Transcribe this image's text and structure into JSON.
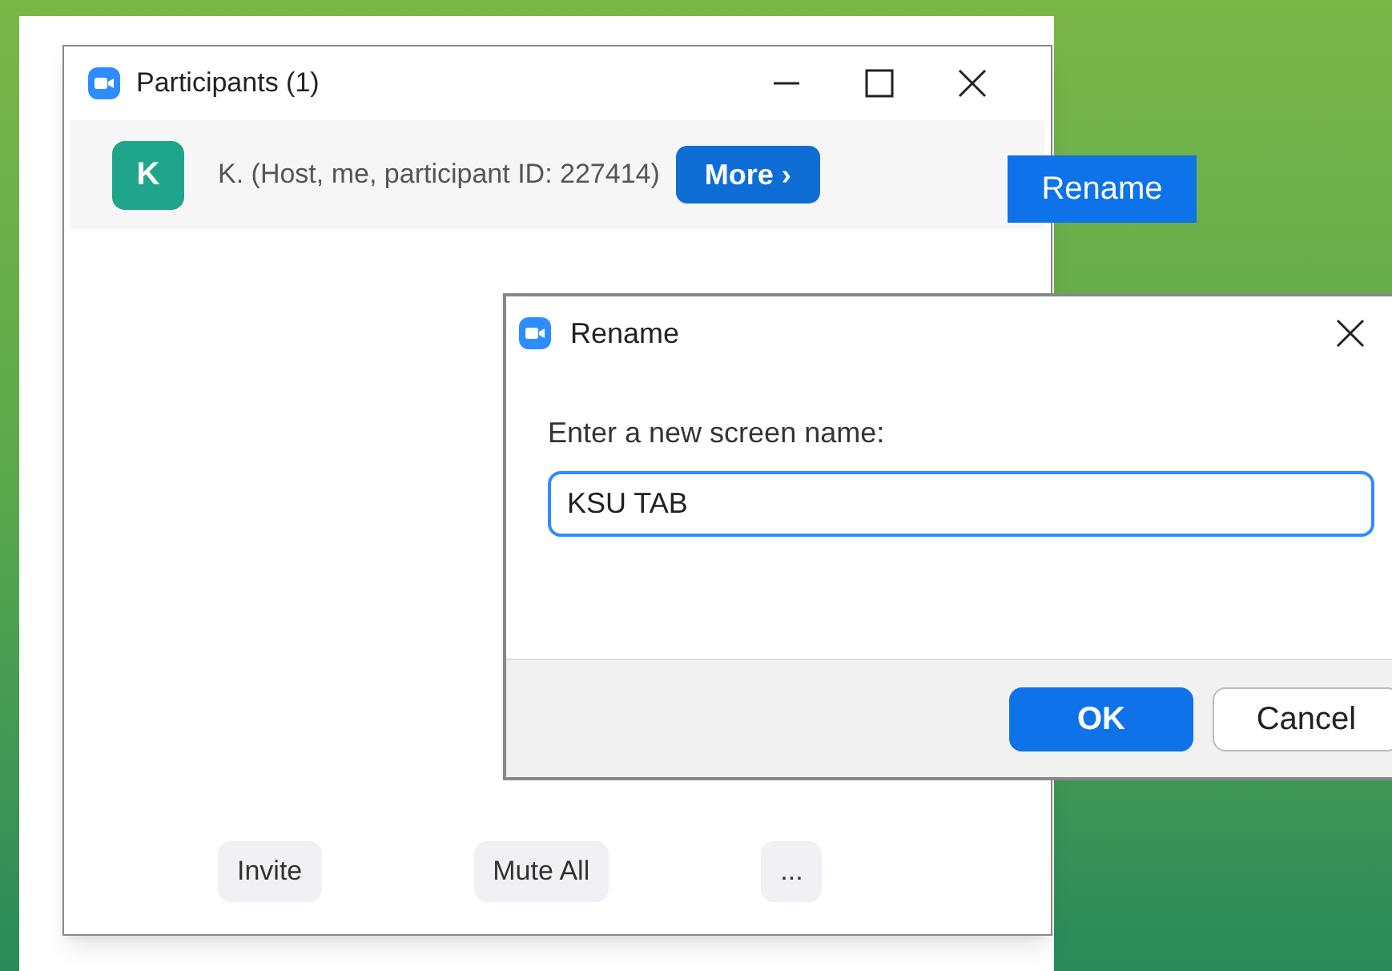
{
  "participants_window": {
    "title": "Participants (1)",
    "participant": {
      "avatar_letter": "K",
      "name": "K. (Host, me, participant ID: 227414)",
      "more_button": "More ›"
    },
    "buttons": [
      "Invite",
      "Mute All",
      "..."
    ]
  },
  "context_menu": {
    "items": [
      "Rename"
    ]
  },
  "rename_dialog": {
    "title": "Rename",
    "prompt": "Enter a new screen name:",
    "value": "KSU TAB",
    "ok_button": "OK",
    "cancel_button": "Cancel"
  }
}
